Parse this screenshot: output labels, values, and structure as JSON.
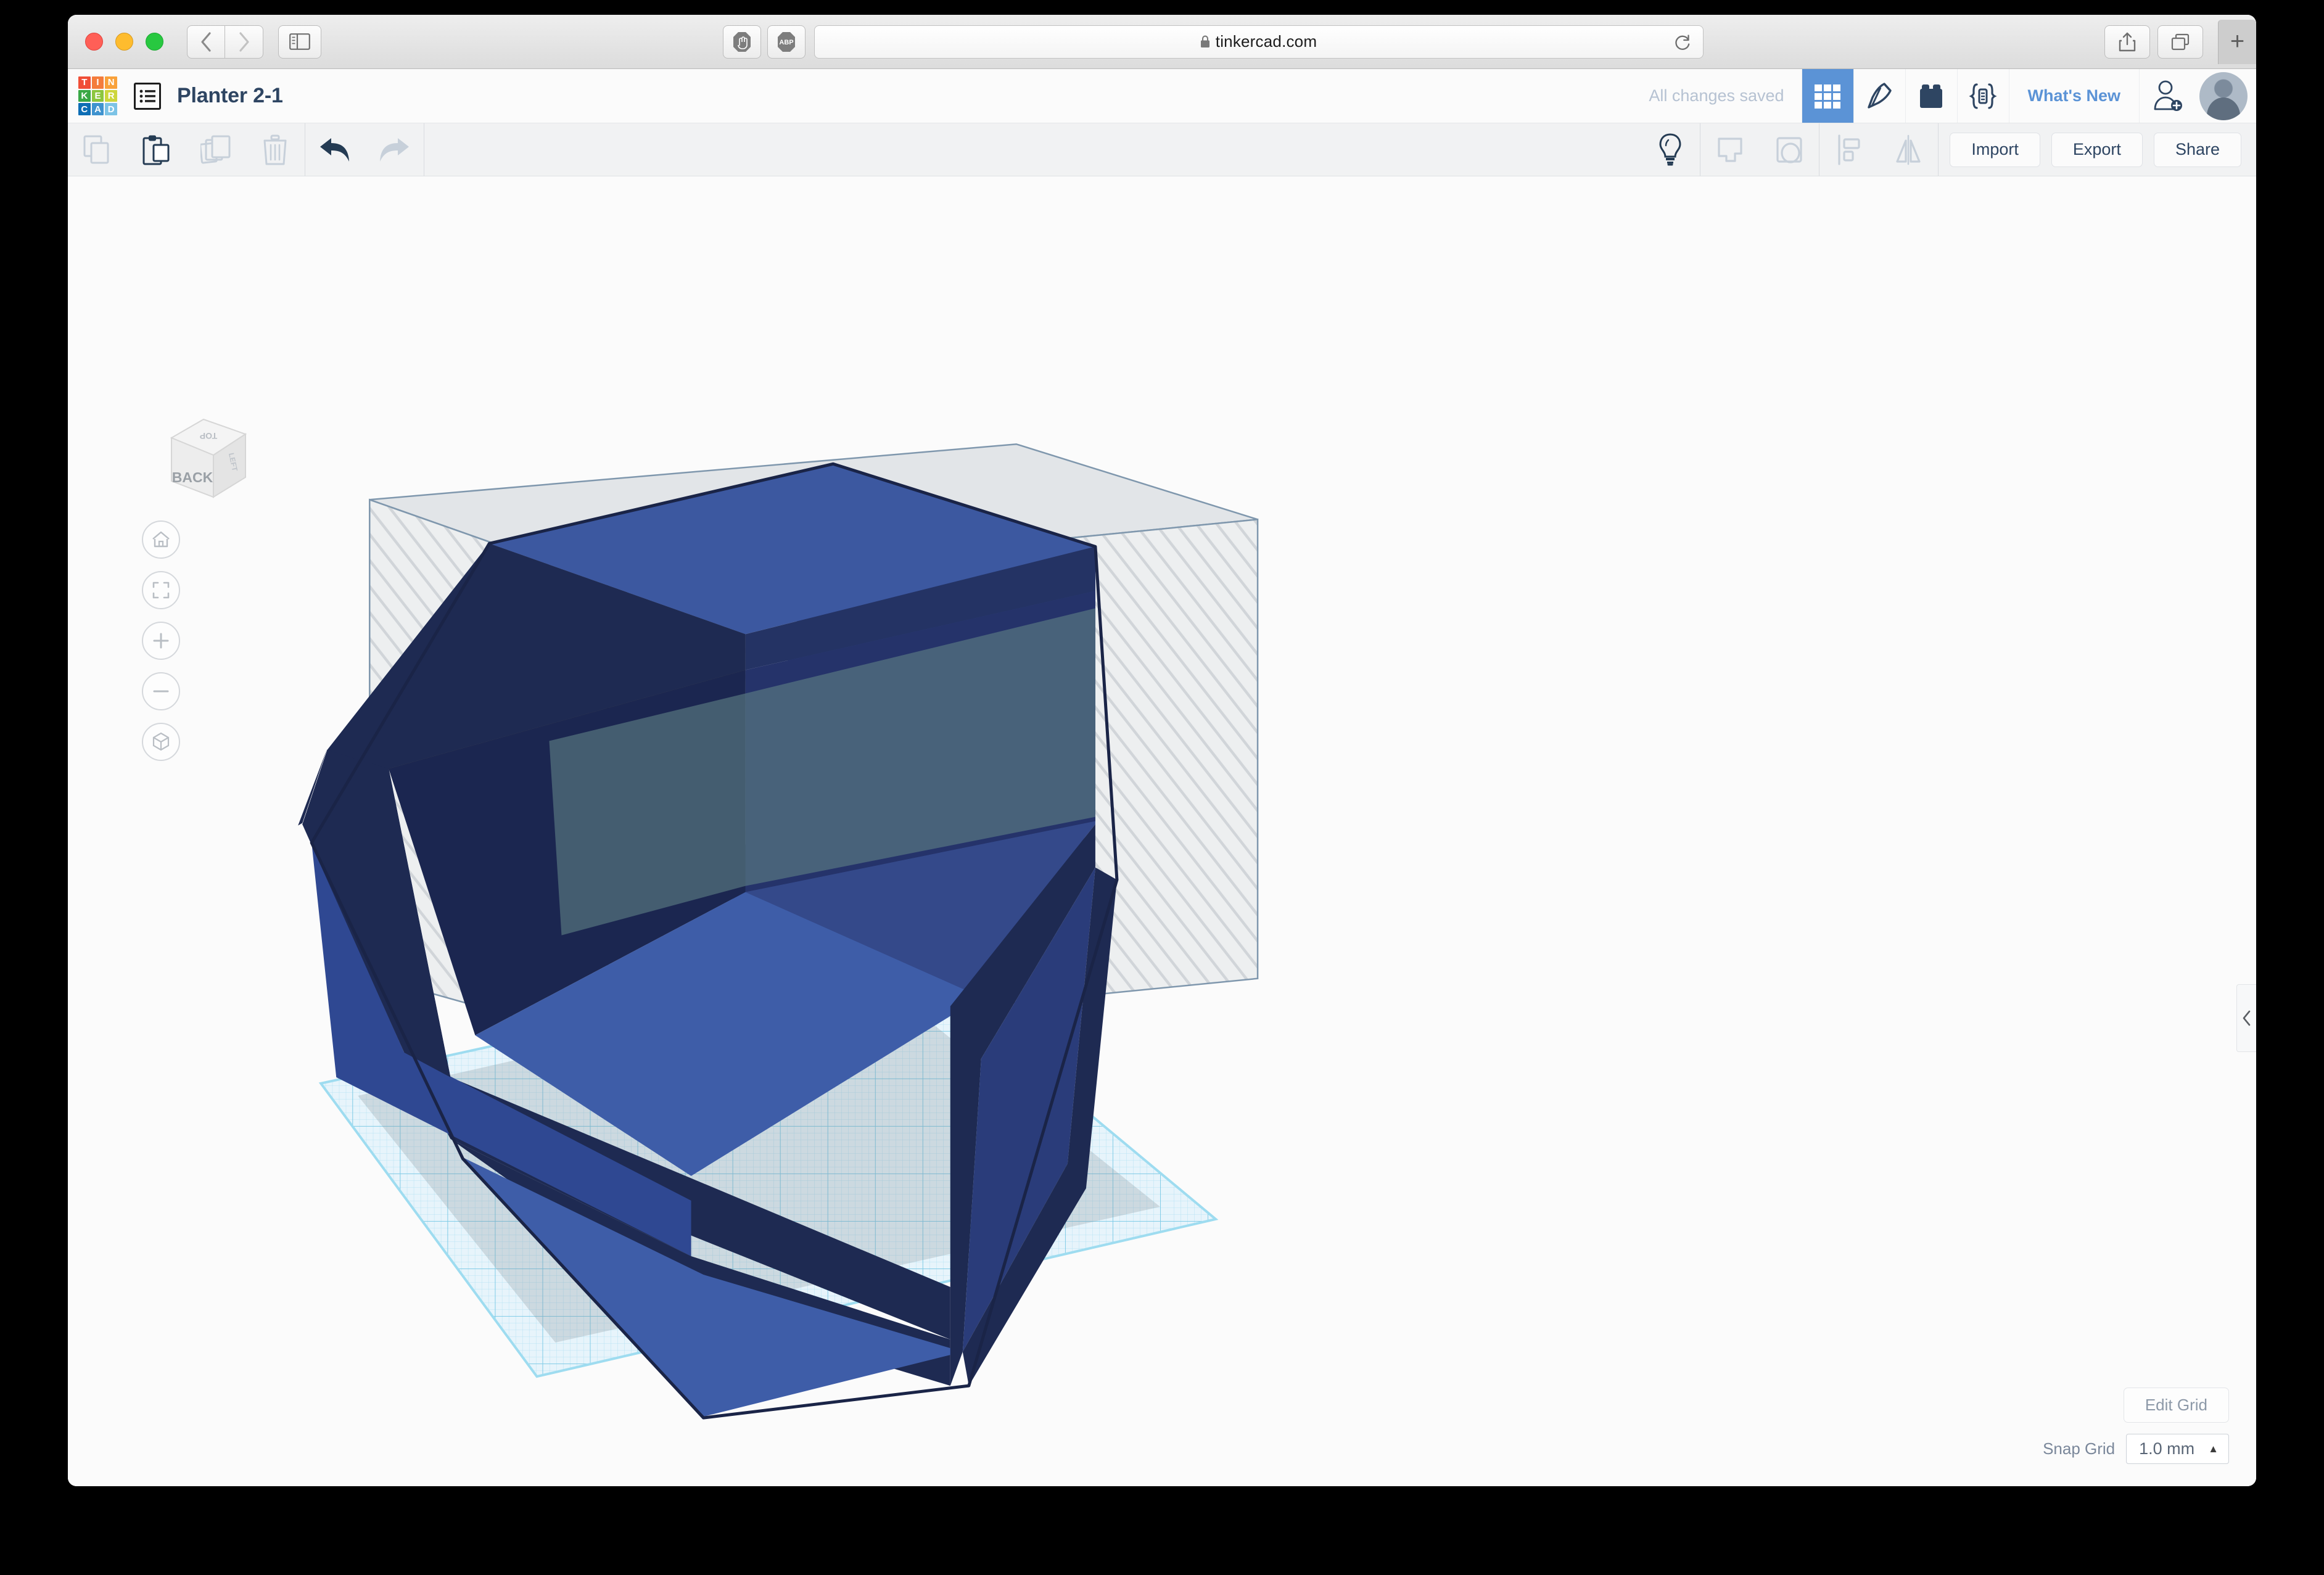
{
  "browser": {
    "url": "tinkercad.com",
    "lock_icon": "lock-icon",
    "back_icon": "chevron-left-icon",
    "forward_icon": "chevron-right-icon",
    "sidebar_icon": "sidebar-panel-icon",
    "reload_icon": "reload-icon",
    "share_icon": "share-upload-icon",
    "tabs_icon": "tab-overview-icon",
    "new_tab_label": "+",
    "extensions": [
      {
        "name": "ghostery-extension-icon",
        "label": ""
      },
      {
        "name": "adblock-plus-extension-icon",
        "label": "ABP"
      }
    ]
  },
  "app": {
    "logo": {
      "name": "tinkercad-logo",
      "tiles": [
        {
          "letter": "T",
          "color": "#f04e37"
        },
        {
          "letter": "I",
          "color": "#f47c3c"
        },
        {
          "letter": "N",
          "color": "#f9a13a"
        },
        {
          "letter": "K",
          "color": "#39a845"
        },
        {
          "letter": "E",
          "color": "#8cc63e"
        },
        {
          "letter": "R",
          "color": "#cdd63c"
        },
        {
          "letter": "C",
          "color": "#0d6eb5"
        },
        {
          "letter": "A",
          "color": "#3f93cf"
        },
        {
          "letter": "D",
          "color": "#7cc3e6"
        }
      ]
    },
    "project_title": "Planter 2-1",
    "save_status": "All changes saved",
    "whats_new_label": "What's New",
    "header_icons": [
      {
        "name": "grid-gallery-icon",
        "active": true
      },
      {
        "name": "codeblocks-pickaxe-icon",
        "active": false
      },
      {
        "name": "lego-brick-icon",
        "active": false
      },
      {
        "name": "code-braces-icon",
        "active": false
      }
    ],
    "add_person_icon": "add-person-icon",
    "avatar": "user-avatar",
    "accent_color": "#5b93d6",
    "title_color": "#2e4562"
  },
  "toolbar": {
    "left_items": [
      {
        "name": "copy-button",
        "icon": "copy-icon",
        "state": "disabled"
      },
      {
        "name": "paste-button",
        "icon": "paste-icon",
        "state": "enabled"
      },
      {
        "name": "duplicate-button",
        "icon": "duplicate-icon",
        "state": "disabled"
      },
      {
        "name": "delete-button",
        "icon": "trash-icon",
        "state": "disabled"
      },
      {
        "name": "undo-button",
        "icon": "undo-arrow-icon",
        "state": "enabled"
      },
      {
        "name": "redo-button",
        "icon": "redo-arrow-icon",
        "state": "disabled"
      }
    ],
    "right_items": [
      {
        "name": "hide-show-button",
        "icon": "lightbulb-icon",
        "state": "enabled"
      },
      {
        "name": "group-button",
        "icon": "group-shapes-icon",
        "state": "disabled"
      },
      {
        "name": "ungroup-button",
        "icon": "ungroup-shapes-icon",
        "state": "disabled"
      },
      {
        "name": "align-button",
        "icon": "align-icon",
        "state": "disabled"
      },
      {
        "name": "mirror-button",
        "icon": "mirror-flip-icon",
        "state": "disabled"
      }
    ],
    "import_label": "Import",
    "export_label": "Export",
    "share_label": "Share"
  },
  "canvas": {
    "view_cube": {
      "name": "view-cube",
      "front_face_label": "BACK",
      "top_face_label": "TOP",
      "right_face_label": "LEFT"
    },
    "nav_buttons": [
      {
        "name": "home-view-button",
        "icon": "home-icon"
      },
      {
        "name": "fit-to-view-button",
        "icon": "fit-frame-icon"
      },
      {
        "name": "zoom-in-button",
        "icon": "plus-icon"
      },
      {
        "name": "zoom-out-button",
        "icon": "minus-icon"
      },
      {
        "name": "orthographic-toggle-button",
        "icon": "cube-ortho-icon"
      }
    ],
    "right_panel_expander_icon": "chevron-left-icon",
    "edit_grid_label": "Edit Grid",
    "snap_grid_label": "Snap Grid",
    "snap_grid_value": "1.0 mm",
    "snap_grid_caret_icon": "caret-up-icon",
    "model": {
      "name": "hexagonal-planter-model",
      "solid_color": "#3c58a0",
      "dark_face_color": "#1e2a52",
      "mid_face_color": "#2c3f74",
      "hole_box_color": "#c9cdd2",
      "workplane_color": "#bfe6f5"
    }
  }
}
